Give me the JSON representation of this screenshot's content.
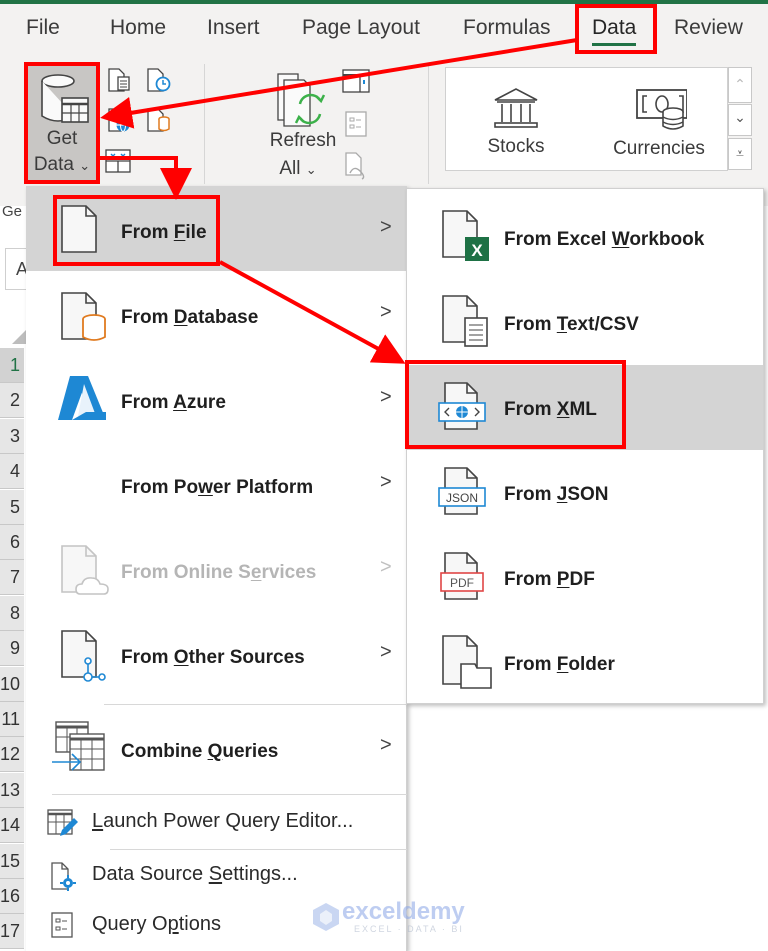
{
  "ribbon_tabs": [
    {
      "label": "File",
      "active": false
    },
    {
      "label": "Home",
      "active": false
    },
    {
      "label": "Insert",
      "active": false
    },
    {
      "label": "Page Layout",
      "active": false
    },
    {
      "label": "Formulas",
      "active": false
    },
    {
      "label": "Data",
      "active": true
    },
    {
      "label": "Review",
      "active": false
    }
  ],
  "ribbon": {
    "get_data": {
      "line1": "Get",
      "line2": "Data",
      "dropdown_glyph": "⌄"
    },
    "refresh_all": {
      "line1": "Refresh",
      "line2": "All",
      "dropdown_glyph": "⌄"
    },
    "data_types": [
      {
        "label": "Stocks",
        "icon": "bank-icon"
      },
      {
        "label": "Currencies",
        "icon": "currency-icon"
      }
    ],
    "gallery_scroll": {
      "up": "⌃",
      "down": "⌄",
      "more": "⩡"
    },
    "group_label_partial": "Ge"
  },
  "namebox_partial": "A",
  "row_headers": [
    "1",
    "2",
    "3",
    "4",
    "5",
    "6",
    "7",
    "8",
    "9",
    "10",
    "11",
    "12",
    "13",
    "14",
    "15",
    "16",
    "17"
  ],
  "get_data_menu": {
    "items": [
      {
        "pre": "From ",
        "accel": "F",
        "post": "ile",
        "has_submenu": true,
        "enabled": true,
        "highlighted": true,
        "icon": "file-icon"
      },
      {
        "pre": "From ",
        "accel": "D",
        "post": "atabase",
        "has_submenu": true,
        "enabled": true,
        "highlighted": false,
        "icon": "database-icon"
      },
      {
        "pre": "From ",
        "accel": "A",
        "post": "zure",
        "has_submenu": true,
        "enabled": true,
        "highlighted": false,
        "icon": "azure-icon"
      },
      {
        "pre": "From Po",
        "accel": "w",
        "post": "er Platform",
        "has_submenu": true,
        "enabled": true,
        "highlighted": false,
        "icon": ""
      },
      {
        "pre": "From Online S",
        "accel": "e",
        "post": "rvices",
        "has_submenu": true,
        "enabled": false,
        "highlighted": false,
        "icon": "cloud-file-icon"
      },
      {
        "pre": "From ",
        "accel": "O",
        "post": "ther Sources",
        "has_submenu": true,
        "enabled": true,
        "highlighted": false,
        "icon": "other-sources-icon"
      },
      {
        "pre": "Combine ",
        "accel": "Q",
        "post": "ueries",
        "has_submenu": true,
        "enabled": true,
        "highlighted": false,
        "icon": "combine-queries-icon"
      }
    ],
    "bottom_items": [
      {
        "pre": "",
        "accel": "L",
        "post": "aunch Power Query Editor...",
        "icon": "power-query-editor-icon"
      },
      {
        "pre": "Data Source ",
        "accel": "S",
        "post": "ettings...",
        "icon": "data-source-settings-icon"
      },
      {
        "pre": "Query O",
        "accel": "p",
        "post": "tions",
        "icon": "query-options-icon"
      }
    ],
    "chevron": ">"
  },
  "from_file_submenu": {
    "items": [
      {
        "pre": "From Excel ",
        "accel": "W",
        "post": "orkbook",
        "icon": "excel-workbook-icon",
        "highlighted": false
      },
      {
        "pre": "From ",
        "accel": "T",
        "post": "ext/CSV",
        "icon": "text-csv-icon",
        "highlighted": false
      },
      {
        "pre": "From ",
        "accel": "X",
        "post": "ML",
        "icon": "xml-icon",
        "highlighted": true
      },
      {
        "pre": "From ",
        "accel": "J",
        "post": "SON",
        "icon": "json-icon",
        "highlighted": false
      },
      {
        "pre": "From ",
        "accel": "P",
        "post": "DF",
        "icon": "pdf-icon",
        "highlighted": false
      },
      {
        "pre": "From ",
        "accel": "F",
        "post": "older",
        "icon": "folder-icon",
        "highlighted": false
      }
    ],
    "icon_text": {
      "excel": "X",
      "json": "JSON",
      "pdf": "PDF"
    }
  },
  "colors": {
    "excel_green": "#217346",
    "annotation_red": "#ff0000",
    "highlight_gray": "#d4d4d4",
    "azure_blue": "#1e88d4",
    "db_orange": "#e07b20",
    "refresh_green": "#3cb14a"
  },
  "watermark": {
    "name": "exceldemy",
    "tagline": "EXCEL · DATA · BI"
  }
}
